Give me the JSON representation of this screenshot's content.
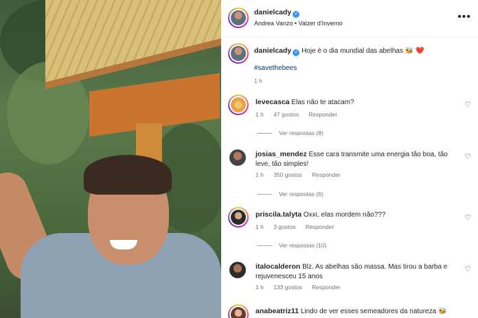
{
  "header": {
    "username": "danielcady",
    "subtitle": "Andrea Vanzo • Valzer d'Inverno",
    "more_icon": "more-horizontal-icon"
  },
  "caption": {
    "username": "danielcady",
    "text": "Hoje é o dia mundial das abelhas 🐝 ❤️",
    "hashtag": "#savethebees",
    "time": "1 h"
  },
  "comments": [
    {
      "username": "levecasca",
      "text": "Elas não te atacam?",
      "text2": "",
      "time": "1 h",
      "likes": "47 gostos",
      "reply": "Responder",
      "replies": "Ver respostas (8)"
    },
    {
      "username": "josias_mendez",
      "text": "Esse cara transmite uma energia tão boa, tão",
      "text2": "leve, tão simples!",
      "time": "1 h",
      "likes": "350 gostos",
      "reply": "Responder",
      "replies": "Ver respostas (6)"
    },
    {
      "username": "priscila.talyta",
      "text": "Oxxi, elas mordem não???",
      "text2": "",
      "time": "1 h",
      "likes": "3 gostos",
      "reply": "Responder",
      "replies": "Ver respostas (10)"
    },
    {
      "username": "italocalderon",
      "text": "Blz. As abelhas são massa. Mas tirou a barba e",
      "text2": "rejuvenesceu 15 anos",
      "time": "1 h",
      "likes": "133 gostos",
      "reply": "Responder",
      "replies": ""
    },
    {
      "username": "anabeatriz11",
      "text": "Lindo de ver esses semeadores da natureza 🐝",
      "text2": "",
      "time": "",
      "likes": "",
      "reply": "",
      "replies": ""
    }
  ],
  "colors": {
    "verified": "#3897f0",
    "link": "#00376b",
    "meta": "#737373"
  }
}
